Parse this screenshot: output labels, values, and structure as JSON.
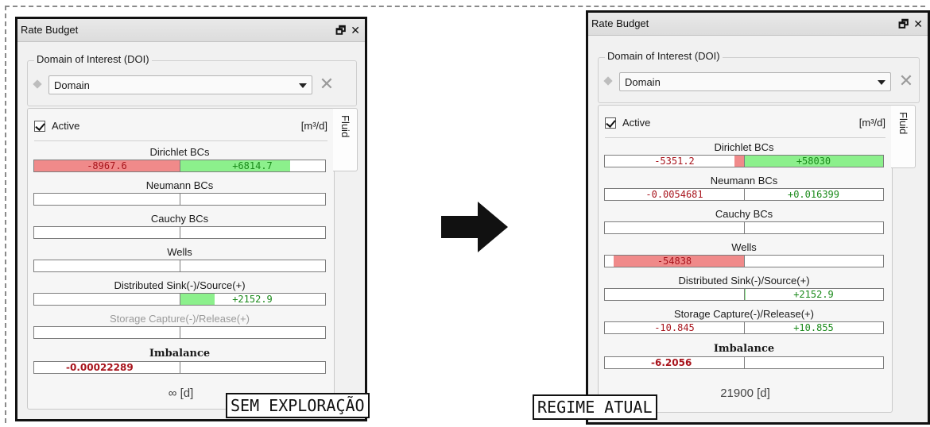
{
  "panels": [
    {
      "title": "Rate Budget",
      "doi_label": "Domain of Interest (DOI)",
      "domain_value": "Domain",
      "active_label": "Active",
      "units": "[m³/d]",
      "side_tab": "Fluid",
      "metrics": [
        {
          "label": "Dirichlet BCs",
          "neg": "-8967.6",
          "pos": "+6814.7",
          "neg_fill": 1.0,
          "pos_fill": 0.76
        },
        {
          "label": "Neumann BCs",
          "neg": "",
          "pos": "",
          "neg_fill": 0,
          "pos_fill": 0
        },
        {
          "label": "Cauchy BCs",
          "neg": "",
          "pos": "",
          "neg_fill": 0,
          "pos_fill": 0
        },
        {
          "label": "Wells",
          "neg": "",
          "pos": "",
          "neg_fill": 0,
          "pos_fill": 0
        },
        {
          "label": "Distributed Sink(-)/Source(+)",
          "neg": "",
          "pos": "+2152.9",
          "neg_fill": 0,
          "pos_fill": 0.24
        },
        {
          "label": "Storage Capture(-)/Release(+)",
          "neg": "",
          "pos": "",
          "neg_fill": 0,
          "pos_fill": 0,
          "disabled": true
        }
      ],
      "imbalance_label": "Imbalance",
      "imbalance_value": "-0.00022289",
      "time": "∞ [d]",
      "caption": "SEM EXPLORAÇÃO"
    },
    {
      "title": "Rate Budget",
      "doi_label": "Domain of Interest (DOI)",
      "domain_value": "Domain",
      "active_label": "Active",
      "units": "[m³/d]",
      "side_tab": "Fluid",
      "metrics": [
        {
          "label": "Dirichlet BCs",
          "neg": "-5351.2",
          "pos": "+58030",
          "neg_fill": 0.07,
          "pos_fill": 1.0
        },
        {
          "label": "Neumann BCs",
          "neg": "-0.0054681",
          "pos": "+0.016399",
          "neg_fill": 0,
          "pos_fill": 0
        },
        {
          "label": "Cauchy BCs",
          "neg": "",
          "pos": "",
          "neg_fill": 0,
          "pos_fill": 0
        },
        {
          "label": "Wells",
          "neg": "-54838",
          "pos": "",
          "neg_fill": 0.94,
          "pos_fill": 0
        },
        {
          "label": "Distributed Sink(-)/Source(+)",
          "neg": "",
          "pos": "+2152.9",
          "neg_fill": 0,
          "pos_fill": 0.01
        },
        {
          "label": "Storage Capture(-)/Release(+)",
          "neg": "-10.845",
          "pos": "+10.855",
          "neg_fill": 0,
          "pos_fill": 0
        }
      ],
      "imbalance_label": "Imbalance",
      "imbalance_value": "-6.2056",
      "time": "21900 [d]",
      "caption": "REGIME ATUAL"
    }
  ],
  "colors": {
    "negative_fill": "#f08a8a",
    "positive_fill": "#8cf08c",
    "negative_text": "#a8141c",
    "positive_text": "#1a8a1a"
  }
}
